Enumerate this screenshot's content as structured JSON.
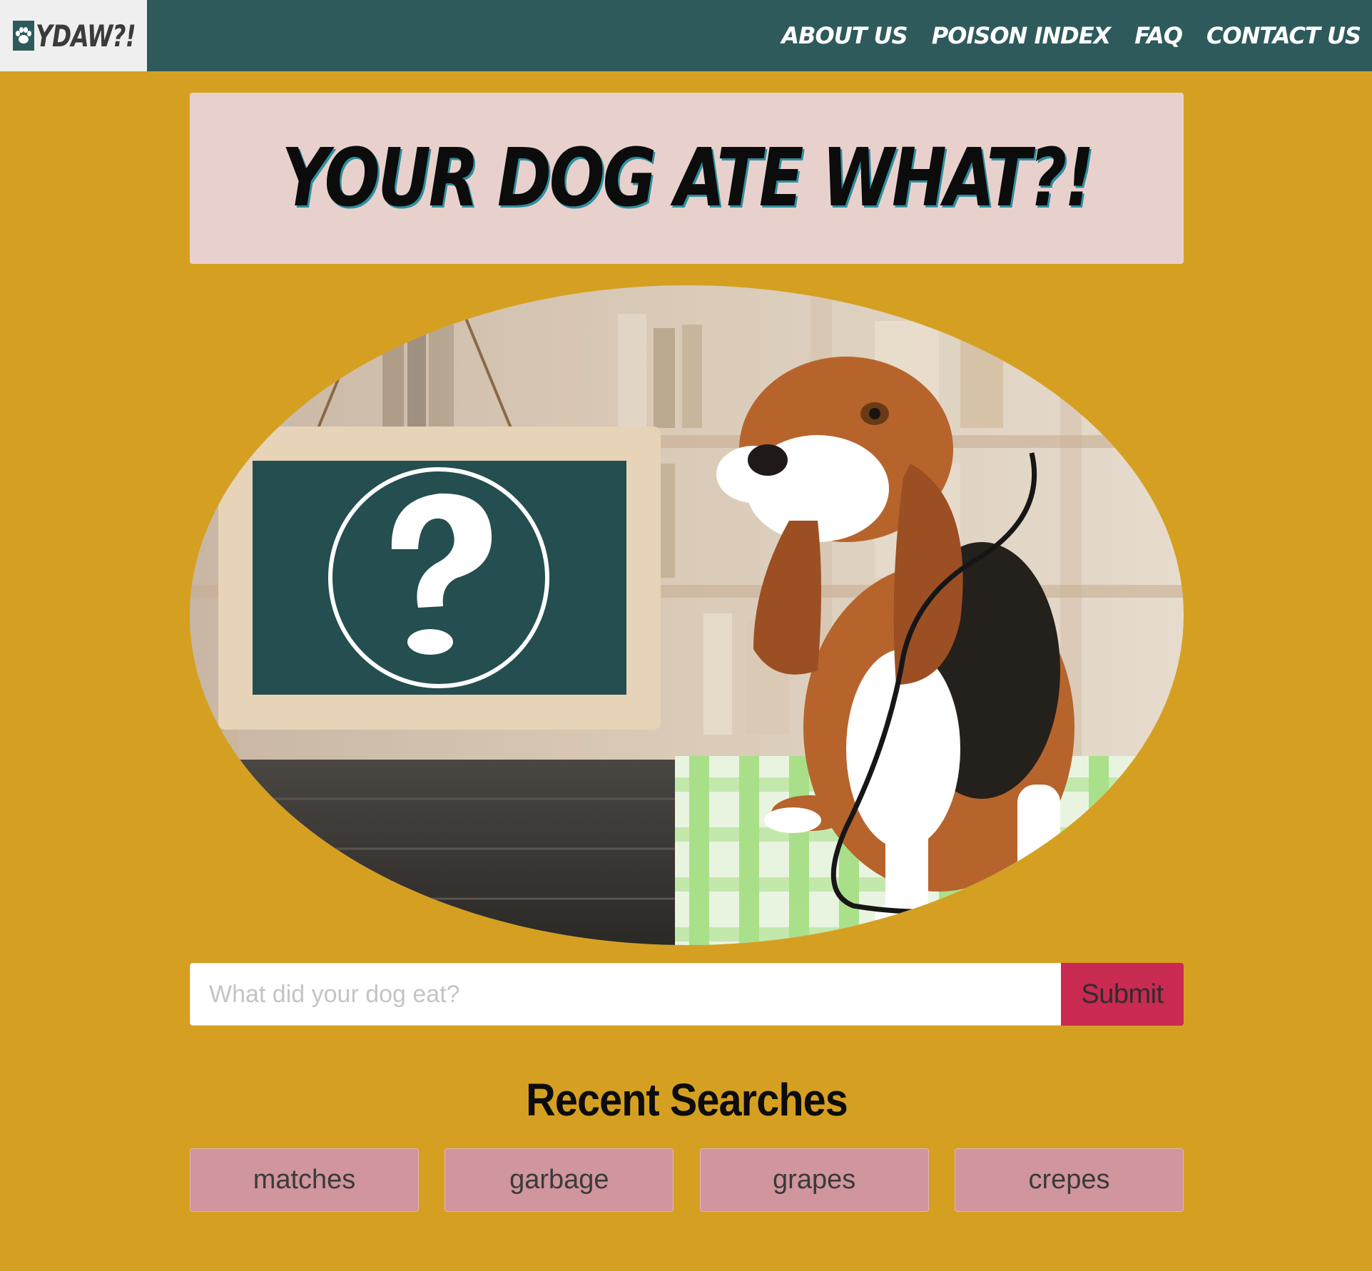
{
  "brand": {
    "name": "YDAW?!",
    "icon": "paw-icon"
  },
  "nav": {
    "items": [
      {
        "label": "ABOUT US"
      },
      {
        "label": "POISON INDEX"
      },
      {
        "label": "FAQ"
      },
      {
        "label": "CONTACT US"
      }
    ]
  },
  "hero": {
    "title": "YOUR DOG ATE WHAT?!",
    "image_alt": "Basset hound with stethoscope next to chalkboard with question mark"
  },
  "search": {
    "placeholder": "What did your dog eat?",
    "value": "",
    "submit_label": "Submit"
  },
  "recent": {
    "heading": "Recent Searches",
    "items": [
      {
        "label": "matches"
      },
      {
        "label": "garbage"
      },
      {
        "label": "grapes"
      },
      {
        "label": "crepes"
      }
    ]
  },
  "colors": {
    "background": "#d5a021",
    "navbar": "#2e5a5c",
    "title_card": "#e8d1cd",
    "submit": "#c92a52",
    "recent_button": "#d1959d"
  }
}
